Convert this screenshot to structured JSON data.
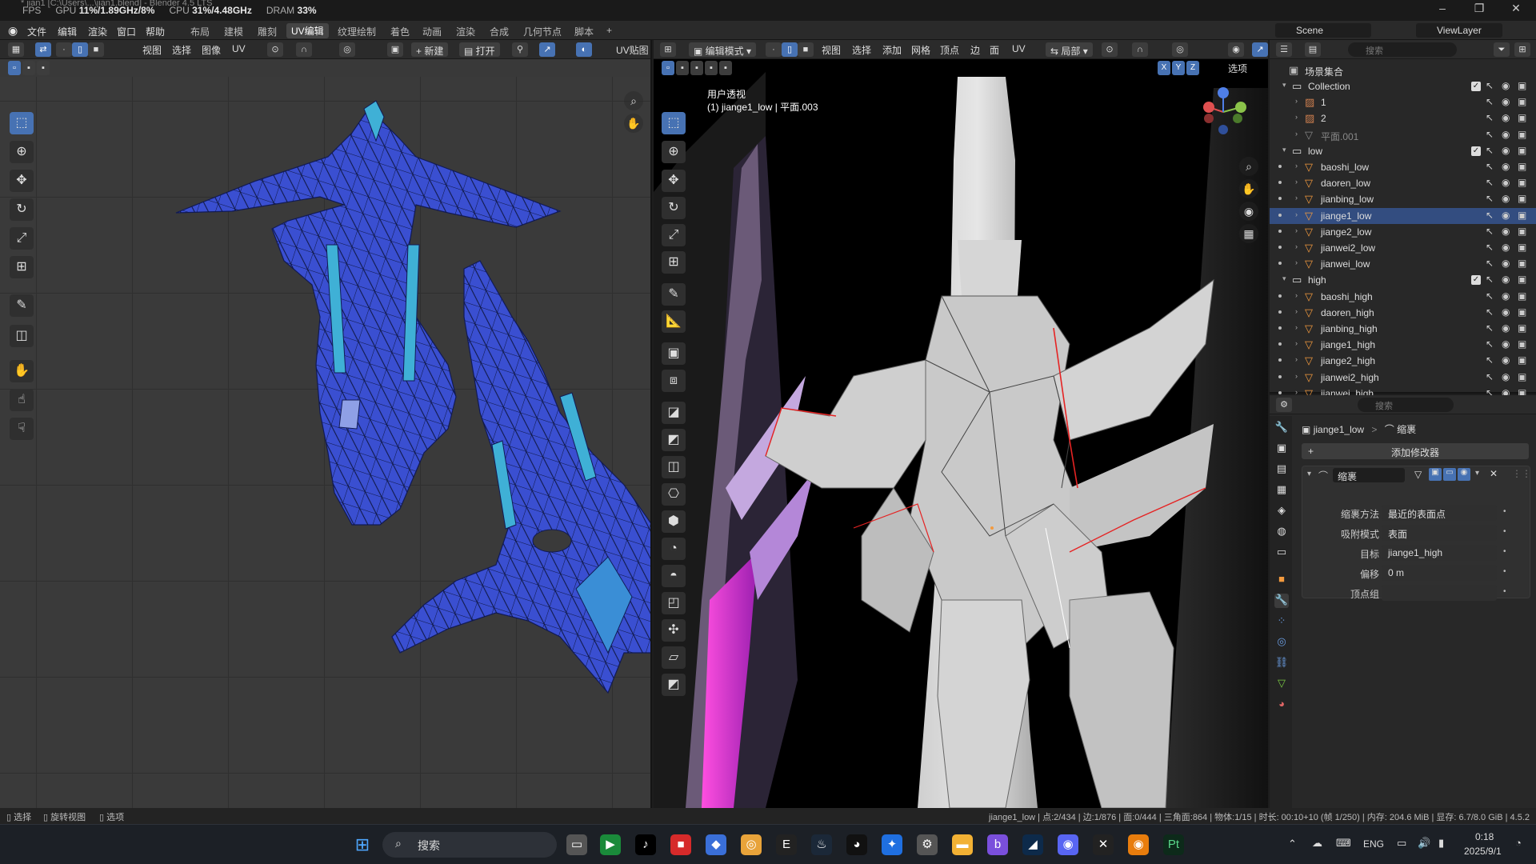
{
  "window": {
    "title": "* jian1 [C:\\Users\\...\\jian1.blend] - Blender 4.5 LTS",
    "hud": {
      "fps_label": "FPS",
      "gpu_label": "GPU",
      "gpu": "11%/1.89GHz/8%",
      "cpu_label": "CPU",
      "cpu": "31%/4.48GHz",
      "dram_label": "DRAM",
      "dram": "33%"
    },
    "controls": [
      "–",
      "❐",
      "✕"
    ]
  },
  "menubar": {
    "menus": [
      "文件",
      "编辑",
      "渲染",
      "窗口",
      "帮助"
    ],
    "workspaces": [
      "布局",
      "建模",
      "雕刻",
      "UV编辑",
      "纹理绘制",
      "着色",
      "动画",
      "渲染",
      "合成",
      "几何节点",
      "脚本",
      "+"
    ],
    "active_workspace": "UV编辑",
    "scene": "Scene",
    "viewlayer": "ViewLayer"
  },
  "uv_editor": {
    "menus": [
      "视图",
      "选择",
      "图像",
      "UV"
    ],
    "new_label": "新建",
    "open_label": "打开",
    "uv_map_label": "UV贴图"
  },
  "viewport": {
    "mode": "编辑模式",
    "menus": [
      "视图",
      "选择",
      "添加",
      "网格",
      "顶点",
      "边",
      "面",
      "UV"
    ],
    "transform": "局部",
    "options_label": "选项",
    "overlay_line1": "用户透视",
    "overlay_line2": "(1) jiange1_low | 平面.003",
    "axes": {
      "x": "X",
      "y": "Y",
      "z": "Z"
    }
  },
  "outliner": {
    "search_placeholder": "搜索",
    "root": "场景集合",
    "items": [
      {
        "name": "Collection",
        "type": "collection",
        "depth": 1
      },
      {
        "name": "1",
        "type": "image",
        "depth": 2
      },
      {
        "name": "2",
        "type": "image",
        "depth": 2
      },
      {
        "name": "平面.001",
        "type": "mesh",
        "depth": 2
      },
      {
        "name": "low",
        "type": "collection",
        "depth": 1
      },
      {
        "name": "baoshi_low",
        "type": "mesh",
        "depth": 2
      },
      {
        "name": "daoren_low",
        "type": "mesh",
        "depth": 2
      },
      {
        "name": "jianbing_low",
        "type": "mesh",
        "depth": 2
      },
      {
        "name": "jiange1_low",
        "type": "mesh",
        "depth": 2,
        "selected": true
      },
      {
        "name": "jiange2_low",
        "type": "mesh",
        "depth": 2
      },
      {
        "name": "jianwei2_low",
        "type": "mesh",
        "depth": 2
      },
      {
        "name": "jianwei_low",
        "type": "mesh",
        "depth": 2
      },
      {
        "name": "high",
        "type": "collection",
        "depth": 1
      },
      {
        "name": "baoshi_high",
        "type": "mesh",
        "depth": 2
      },
      {
        "name": "daoren_high",
        "type": "mesh",
        "depth": 2
      },
      {
        "name": "jianbing_high",
        "type": "mesh",
        "depth": 2
      },
      {
        "name": "jiange1_high",
        "type": "mesh",
        "depth": 2
      },
      {
        "name": "jiange2_high",
        "type": "mesh",
        "depth": 2
      },
      {
        "name": "jianwei2_high",
        "type": "mesh",
        "depth": 2
      },
      {
        "name": "jianwei_high",
        "type": "mesh",
        "depth": 2
      }
    ]
  },
  "properties": {
    "search_placeholder": "搜索",
    "breadcrumb_object": "jiange1_low",
    "breadcrumb_sep": ">",
    "breadcrumb_mod": "缩裹",
    "add_modifier": "添加修改器",
    "modifier_name": "缩裹",
    "fields": [
      {
        "label": "缩裹方法",
        "value": "最近的表面点"
      },
      {
        "label": "吸附模式",
        "value": "表面"
      },
      {
        "label": "目标",
        "value": "jiange1_high"
      },
      {
        "label": "偏移",
        "value": "0 m"
      },
      {
        "label": "顶点组",
        "value": ""
      }
    ]
  },
  "statusbar": {
    "left": [
      "选择",
      "旋转视图",
      "选项"
    ],
    "right": "jiange1_low | 点:2/434 | 边:1/876 | 面:0/444 | 三角面:864 | 物体:1/15 | 时长: 00:10+10 (帧 1/250) | 内存: 204.6 MiB | 显存: 6.7/8.0 GiB | 4.5.2"
  },
  "taskbar": {
    "search_label": "搜索",
    "lang": "ENG",
    "time": "0:18",
    "date": "2025/9/1"
  },
  "colors": {
    "accent": "#4772b3",
    "uv_blue": "#3a4fd1",
    "uv_cyan": "#3fb0d6"
  }
}
